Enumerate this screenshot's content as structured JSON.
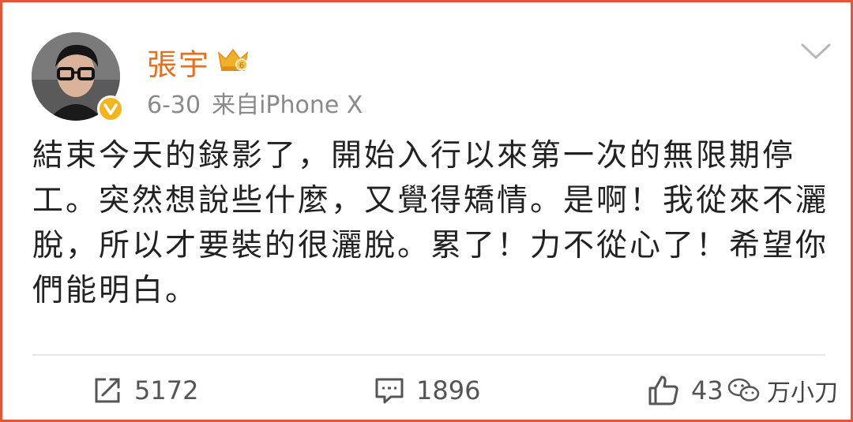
{
  "post": {
    "author": "張宇",
    "date": "6-30",
    "source": "来自iPhone X",
    "text": "結束今天的錄影了，開始入行以來第一次的無限期停工。突然想說些什麼，又覺得矯情。是啊！我從來不灑脫，所以才要裝的很灑脫。累了！力不從心了！希望你們能明白。"
  },
  "actions": {
    "repost_count": "5172",
    "comment_count": "1896",
    "like_count": "43"
  },
  "watermark": {
    "text": "万小刀"
  },
  "icons": {
    "verified": "verified-badge-icon",
    "crown": "vip-crown-icon",
    "menu": "chevron-down-icon",
    "repost": "repost-icon",
    "comment": "comment-icon",
    "like": "thumbs-up-icon",
    "wechat": "wechat-icon"
  },
  "colors": {
    "border": "#e5553a",
    "username": "#e8701c",
    "verified": "#f3b51d",
    "meta": "#8a8a8a"
  }
}
